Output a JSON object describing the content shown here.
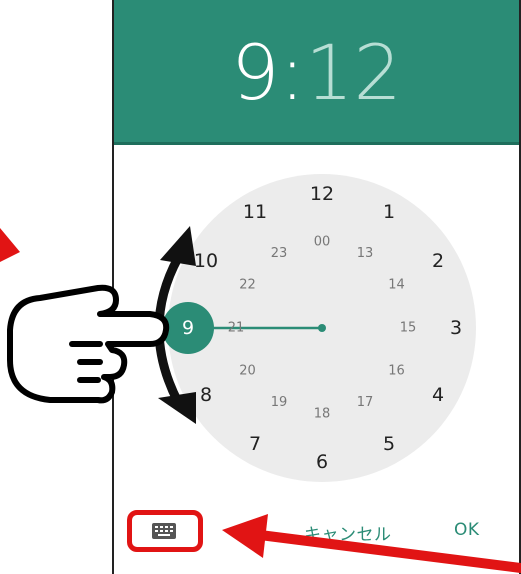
{
  "header": {
    "hour": "9",
    "separator": ":",
    "minute": "12"
  },
  "clock": {
    "outer_hours": [
      "12",
      "1",
      "2",
      "3",
      "4",
      "5",
      "6",
      "7",
      "8",
      "9",
      "10",
      "11"
    ],
    "inner_hours": [
      "00",
      "13",
      "14",
      "15",
      "16",
      "17",
      "18",
      "19",
      "20",
      "21",
      "22",
      "23"
    ],
    "selected_hour": "9"
  },
  "footer": {
    "keyboard_icon": "keyboard-icon",
    "cancel_label": "キャンセル",
    "ok_label": "OK"
  },
  "colors": {
    "accent": "#2b8c76",
    "dial_bg": "#ececec",
    "annotation_red": "#e11414"
  },
  "annotations": {
    "hand_icon": "pointing-hand-icon",
    "rotate_arrow": "curved-double-arrow-icon",
    "pointer_arrow": "red-arrow-icon"
  }
}
